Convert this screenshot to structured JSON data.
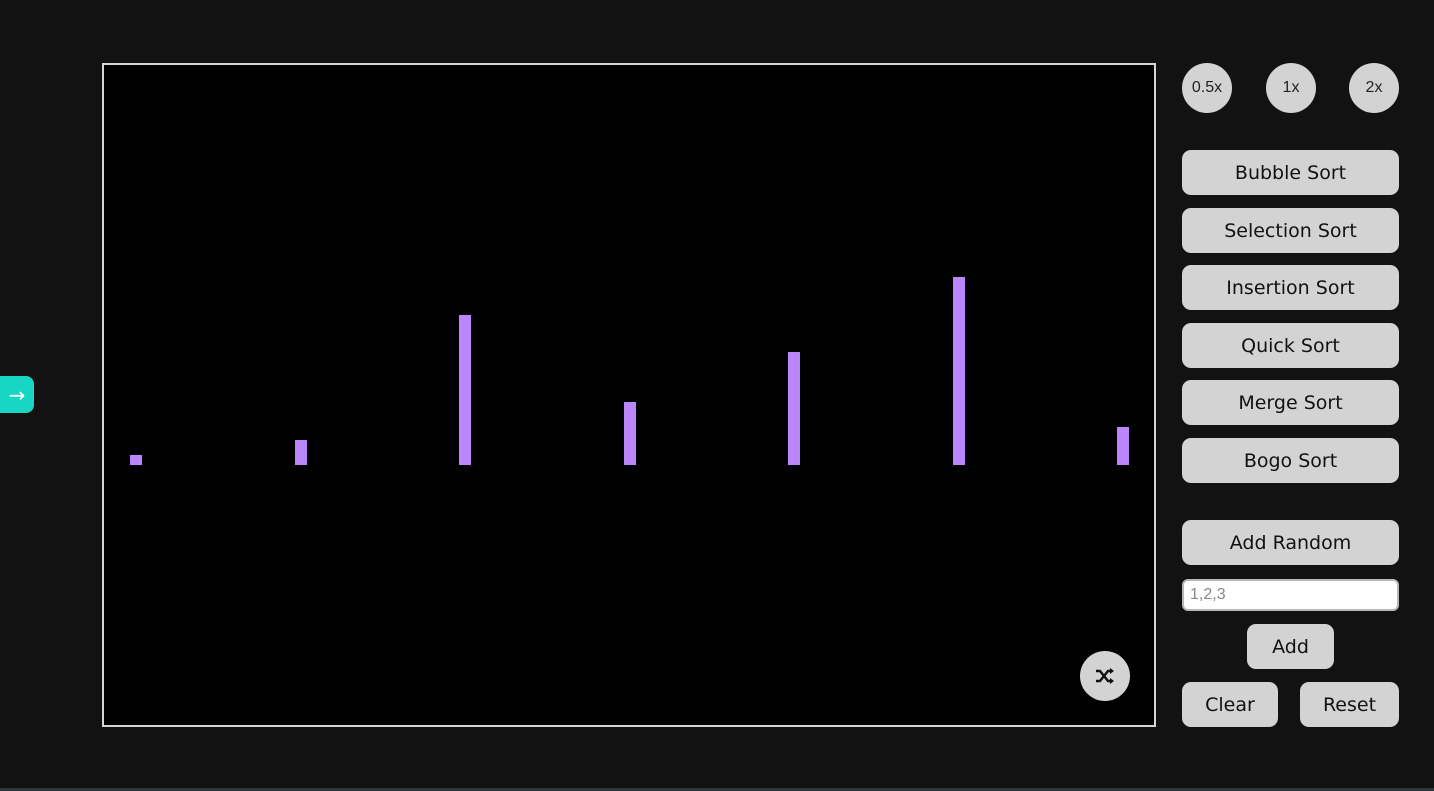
{
  "sidebar_toggle": {
    "icon": "arrow-right-icon",
    "glyph": "→"
  },
  "visualizer": {
    "bar_color": "#bb86fc",
    "values": [
      10,
      25,
      150,
      63,
      113,
      188,
      38
    ],
    "shuffle_icon": "shuffle-icon"
  },
  "speed": {
    "options": [
      "0.5x",
      "1x",
      "2x"
    ]
  },
  "algorithms": [
    "Bubble Sort",
    "Selection Sort",
    "Insertion Sort",
    "Quick Sort",
    "Merge Sort",
    "Bogo Sort"
  ],
  "actions": {
    "add_random": "Add Random",
    "input_placeholder": "1,2,3",
    "input_value": "",
    "add": "Add",
    "clear": "Clear",
    "reset": "Reset"
  }
}
